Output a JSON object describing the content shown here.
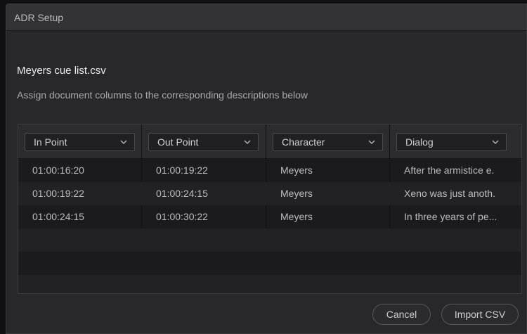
{
  "window": {
    "title": "ADR Setup"
  },
  "file_title": "Meyers cue list.csv",
  "instructions": "Assign document columns to the corresponding descriptions below",
  "columns": [
    {
      "label": "In Point"
    },
    {
      "label": "Out Point"
    },
    {
      "label": "Character"
    },
    {
      "label": "Dialog"
    }
  ],
  "rows": [
    [
      "01:00:16:20",
      "01:00:19:22",
      "Meyers",
      "After the armistice e."
    ],
    [
      "01:00:19:22",
      "01:00:24:15",
      "Meyers",
      "Xeno was just anoth."
    ],
    [
      "01:00:24:15",
      "01:00:30:22",
      "Meyers",
      "In three years of pe..."
    ]
  ],
  "buttons": {
    "cancel": "Cancel",
    "import": "Import CSV"
  }
}
